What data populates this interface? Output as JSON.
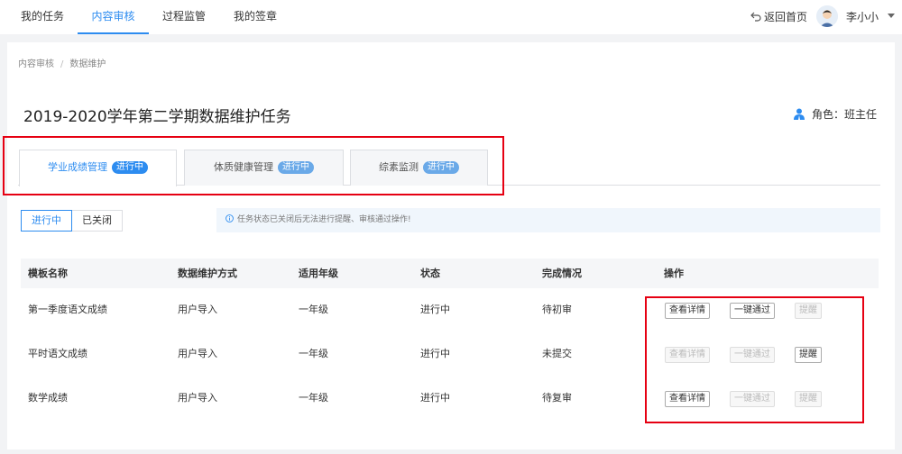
{
  "topnav": {
    "items": [
      {
        "label": "我的任务",
        "active": false
      },
      {
        "label": "内容审核",
        "active": true
      },
      {
        "label": "过程监管",
        "active": false
      },
      {
        "label": "我的签章",
        "active": false
      }
    ],
    "back_label": "返回首页",
    "username": "李小小"
  },
  "breadcrumb": [
    "内容审核",
    "数据维护"
  ],
  "page_title": "2019-2020学年第二学期数据维护任务",
  "role_label": "角色：班主任",
  "tabs": [
    {
      "label": "学业成绩管理",
      "badge": "进行中",
      "active": true
    },
    {
      "label": "体质健康管理",
      "badge": "进行中",
      "active": false
    },
    {
      "label": "综素监测",
      "badge": "进行中",
      "active": false
    }
  ],
  "filter": {
    "options": [
      "进行中",
      "已关闭"
    ],
    "selected": "进行中"
  },
  "notice": "任务状态已关闭后无法进行提醒、审核通过操作!",
  "table": {
    "headers": [
      "模板名称",
      "数据维护方式",
      "适用年级",
      "状态",
      "完成情况",
      "操作"
    ],
    "rows": [
      {
        "name": "第一季度语文成绩",
        "method": "用户导入",
        "grade": "一年级",
        "status": "进行中",
        "progress": "待初审",
        "actions": {
          "detail": "查看详情",
          "approve": "一键通过",
          "remind": "提醒"
        },
        "enabled": {
          "detail": true,
          "approve": true,
          "remind": false
        }
      },
      {
        "name": "平时语文成绩",
        "method": "用户导入",
        "grade": "一年级",
        "status": "进行中",
        "progress": "未提交",
        "actions": {
          "detail": "查看详情",
          "approve": "一键通过",
          "remind": "提醒"
        },
        "enabled": {
          "detail": false,
          "approve": false,
          "remind": true
        }
      },
      {
        "name": "数学成绩",
        "method": "用户导入",
        "grade": "一年级",
        "status": "进行中",
        "progress": "待复审",
        "actions": {
          "detail": "查看详情",
          "approve": "一键通过",
          "remind": "提醒"
        },
        "enabled": {
          "detail": true,
          "approve": false,
          "remind": false
        }
      }
    ]
  },
  "colors": {
    "accent": "#2d8cf0",
    "highlight": "#e60012"
  }
}
